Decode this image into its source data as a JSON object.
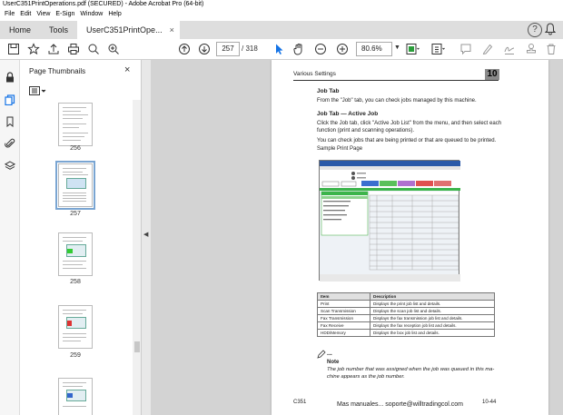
{
  "window": {
    "title": "UserC351PrintOperations.pdf (SECURED) - Adobe Acrobat Pro (64-bit)"
  },
  "menu": [
    "File",
    "Edit",
    "View",
    "E-Sign",
    "Window",
    "Help"
  ],
  "tabs": {
    "home": "Home",
    "tools": "Tools",
    "doc": "UserC351PrintOpe...",
    "close": "×",
    "help": "?"
  },
  "toolbar": {
    "page_current": "257",
    "page_sep_total": "/ 318",
    "zoom": "80.6%"
  },
  "sidebar": {
    "title": "Page Thumbnails",
    "close": "×",
    "thumbnails": [
      {
        "label": "256"
      },
      {
        "label": "257",
        "selected": true
      },
      {
        "label": "258"
      },
      {
        "label": "259"
      }
    ]
  },
  "page": {
    "header_left": "Various Settings",
    "section_number": "10",
    "heading1": "Job Tab",
    "p1": "From the \"Job\" tab, you can check jobs managed by this machine.",
    "heading2": "Job Tab — Active Job",
    "p2a": "Click the Job tab, click \"Active Job List\" from the menu, and then select each",
    "p2b": "function (print and scanning operations).",
    "p3": "You can check jobs that are being printed or that are queued to be printed.",
    "p4": "Sample Print Page",
    "table": {
      "headers": [
        "Item",
        "Description"
      ],
      "rows": [
        [
          "Print",
          "Displays the print job list and details."
        ],
        [
          "Scan Transmission",
          "Displays the scan job list and details."
        ],
        [
          "Fax Transmission",
          "Displays the fax transmission job list and details."
        ],
        [
          "Fax Receive",
          "Displays the fax reception job list and details."
        ],
        [
          "HDD/Memory",
          "Displays the box job list and details."
        ]
      ]
    },
    "note_dots": "...",
    "note_title": "Note",
    "note_l1": "The job number that was assigned when the job was queued in this ma-",
    "note_l2": "chine appears as the job number.",
    "footer_left": "C351",
    "footer_center": "Mas manuales... soporte@willtradingcol.com",
    "footer_right": "10-44"
  },
  "colors": {
    "accent": "#1473e6",
    "tab_bar": "#dedede",
    "viewer_bg": "#d3d3d3"
  }
}
